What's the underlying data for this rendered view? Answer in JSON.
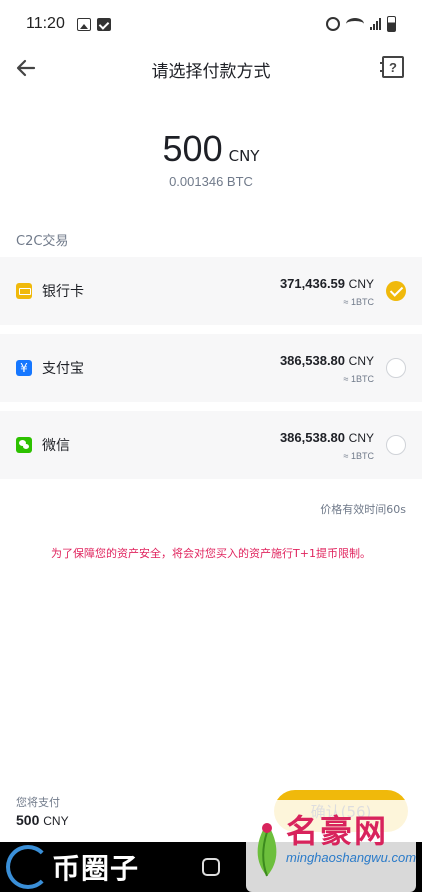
{
  "status_bar": {
    "time": "11:20"
  },
  "header": {
    "title": "请选择付款方式"
  },
  "amount": {
    "value": "500",
    "currency": "CNY",
    "btc": "0.001346 BTC"
  },
  "section": {
    "label": "C2C交易"
  },
  "payment_options": [
    {
      "label": "银行卡",
      "price": "371,436.59",
      "unit": "CNY",
      "btc": "≈ 1BTC",
      "icon": "bank-card-icon",
      "selected": true
    },
    {
      "label": "支付宝",
      "price": "386,538.80",
      "unit": "CNY",
      "btc": "≈ 1BTC",
      "icon": "alipay-icon",
      "selected": false
    },
    {
      "label": "微信",
      "price": "386,538.80",
      "unit": "CNY",
      "btc": "≈ 1BTC",
      "icon": "wechat-icon",
      "selected": false
    }
  ],
  "validity": "价格有效时间60s",
  "warning": "为了保障您的资产安全，将会对您买入的资产施行T+1提币限制。",
  "footer": {
    "caption": "您将支付",
    "total": "500",
    "unit": "CNY",
    "confirm": "确认(56)"
  },
  "watermarks": {
    "left": "币圈子",
    "right_title": "名豪网",
    "right_sub": "minghaoshangwu.com"
  },
  "colors": {
    "accent": "#f0b90b",
    "warning": "#e0245e",
    "alipay": "#1677ff",
    "wechat": "#2dc100"
  }
}
